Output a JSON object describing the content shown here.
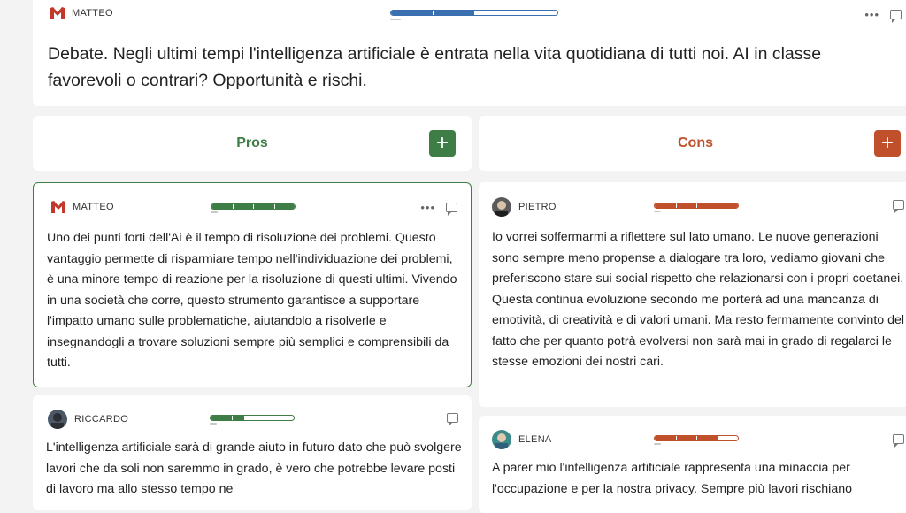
{
  "header": {
    "author": "MATTEO",
    "progress": 0.5,
    "question": "Debate. Negli ultimi tempi l'intelligenza artificiale è entrata nella vita quotidiana di tutti noi. AI in classe favorevoli o contrari? Opportunità e rischi.",
    "options_icon": "more-dots-icon",
    "comment_icon": "comment-icon"
  },
  "columns": {
    "pros": {
      "title": "Pros",
      "add_label": "+",
      "color": "#3f7d47"
    },
    "cons": {
      "title": "Cons",
      "add_label": "+",
      "color": "#c0502c"
    }
  },
  "posts": {
    "pros": [
      {
        "author": "MATTEO",
        "progress": 1.0,
        "text": "Uno dei punti forti dell'Ai è il tempo di risoluzione dei problemi. Questo vantaggio permette di risparmiare tempo nell'individuazione dei problemi, è una minore tempo di reazione per la risoluzione di questi ultimi. Vivendo in una società che corre, questo strumento garantisce a supportare l'impatto umano sulle problematiche, aiutandolo a risolverle e insegnandogli a trovare soluzioni sempre più semplici e comprensibili da tutti."
      },
      {
        "author": "RICCARDO",
        "progress": 0.4,
        "text": "L'intelligenza artificiale sarà di grande aiuto in futuro dato che può svolgere lavori che da soli non saremmo in grado, è vero che potrebbe levare posti di lavoro ma allo stesso tempo ne"
      }
    ],
    "cons": [
      {
        "author": "PIETRO",
        "progress": 1.0,
        "text": "Io vorrei soffermarmi a riflettere sul lato umano. Le nuove generazioni sono sempre meno propense a dialogare tra loro, vediamo giovani che preferiscono stare sui social rispetto che relazionarsi con i propri coetanei. Questa continua evoluzione secondo me porterà ad una mancanza di emotività, di creatività e di valori umani. Ma resto fermamente convinto del fatto che per quanto potrà evolversi non sarà mai in grado di regalarci le stesse emozioni dei nostri cari."
      },
      {
        "author": "ELENA",
        "progress": 0.75,
        "text": "A parer mio l'intelligenza artificiale rappresenta una minaccia per l'occupazione e per la nostra privacy. Sempre più lavori rischiano"
      }
    ]
  }
}
